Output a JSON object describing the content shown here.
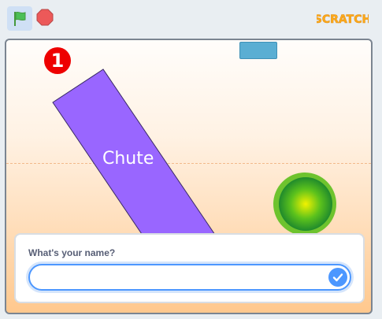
{
  "toolbar": {
    "green_flag_icon": "green-flag-icon",
    "stop_icon": "stop-sign-icon",
    "logo_text": "SCRATCH"
  },
  "stage": {
    "monitor_badge": "1",
    "sprites": {
      "chute_label": "Chute",
      "chute_color": "#9966ff",
      "ball_color": "#2fa82a",
      "marker_color": "#5aaed3"
    }
  },
  "ask_prompt": {
    "question": "What's your name?",
    "input_value": "",
    "submit_icon": "checkmark-icon"
  },
  "colors": {
    "accent": "#4c97ff",
    "badge": "#ee0000"
  }
}
